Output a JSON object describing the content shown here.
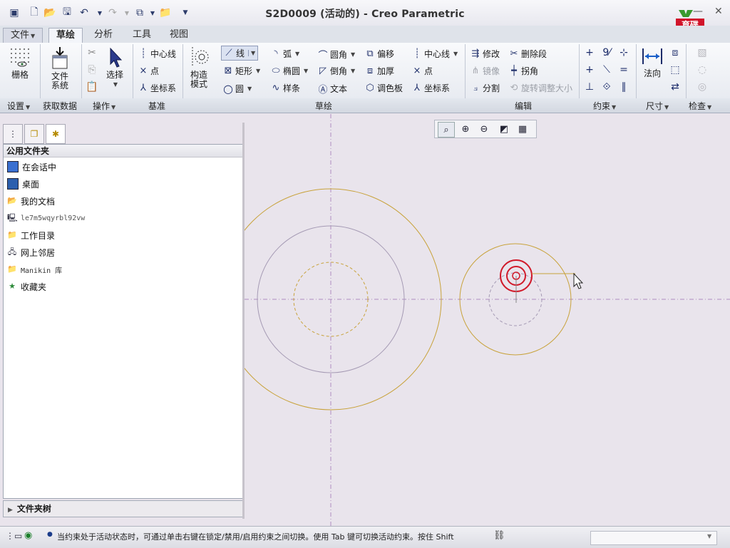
{
  "window": {
    "title": "S2D0009 (活动的) - Creo Parametric",
    "minimize": "—",
    "close": "✕",
    "help": "?"
  },
  "logo_text": "育碟软件",
  "tabs": [
    {
      "label": "文件"
    },
    {
      "label": "草绘"
    },
    {
      "label": "分析"
    },
    {
      "label": "工具"
    },
    {
      "label": "视图"
    }
  ],
  "ribbon": {
    "setup": {
      "grid": "栅格",
      "group": "设置"
    },
    "get_data": {
      "file_system": [
        "文件",
        "系统"
      ],
      "group": "获取数据"
    },
    "operations": {
      "select": "选择",
      "group": "操作"
    },
    "datum": {
      "centerline": "中心线",
      "point": "点",
      "csys": "坐标系",
      "group": "基准"
    },
    "construction": {
      "label": [
        "构造",
        "模式"
      ]
    },
    "sketching": {
      "line": "线",
      "rectangle": "矩形",
      "circle": "圆",
      "arc": "弧",
      "ellipse": "椭圆",
      "spline": "样条",
      "fillet": "圆角",
      "chamfer": "倒角",
      "text": "文本",
      "offset": "偏移",
      "thicken": "加厚",
      "palette": "调色板",
      "centerline": "中心线",
      "point": "点",
      "csys": "坐标系",
      "group": "草绘"
    },
    "editing": {
      "modify": "修改",
      "delete_segment": "删除段",
      "mirror": "镜像",
      "corner": "拐角",
      "divide": "分割",
      "rotate_resize": "旋转调整大小",
      "group": "编辑"
    },
    "constrain": {
      "group": "约束"
    },
    "dimension": {
      "normal": "法向",
      "group": "尺寸"
    },
    "inspect": {
      "group": "检查"
    }
  },
  "panel": {
    "header": "公用文件夹",
    "items": [
      {
        "label": "在会话中",
        "icon": "session-icon"
      },
      {
        "label": "桌面",
        "icon": "desktop-icon"
      },
      {
        "label": "我的文档",
        "icon": "documents-icon"
      },
      {
        "label": "le7m5wqyrbl92vw",
        "icon": "computer-icon"
      },
      {
        "label": "工作目录",
        "icon": "working-dir-icon"
      },
      {
        "label": "网上邻居",
        "icon": "network-icon"
      },
      {
        "label": "Manikin 库",
        "icon": "library-icon"
      },
      {
        "label": "收藏夹",
        "icon": "favorites-icon"
      }
    ],
    "tree": "文件夹树"
  },
  "status": {
    "message": "当约束处于活动状态时，可通过单击右键在锁定/禁用/启用约束之间切换。使用 Tab 键可切换活动约束。按住 Shift"
  },
  "colors": {
    "canvas_bg": "#e9e4ec",
    "sketch_line": "#c8a23a",
    "construction": "#a59ab4",
    "active_circle": "#d11a2a",
    "centerline": "#b08cc0"
  }
}
